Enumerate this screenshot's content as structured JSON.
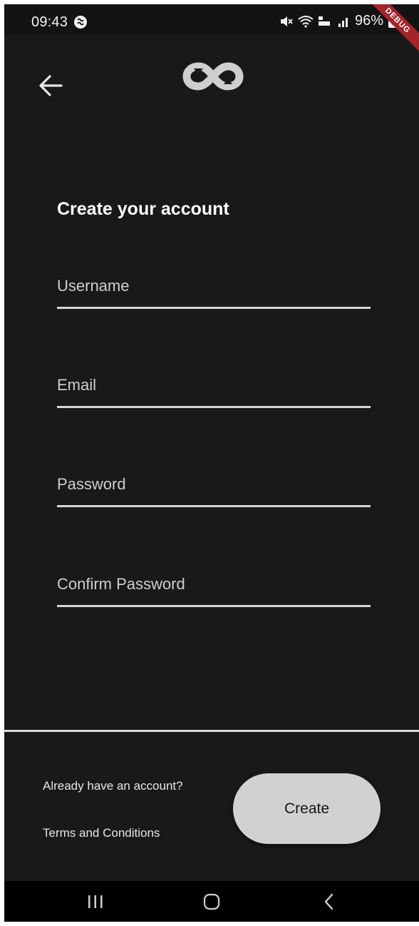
{
  "status_bar": {
    "time": "09:43",
    "battery": "96%",
    "icons": [
      "app-notification-icon",
      "mute-icon",
      "wifi-icon",
      "volte-icon",
      "signal-icon",
      "battery-charging-icon"
    ]
  },
  "debug_banner": "DEBUG",
  "header": {
    "back_icon": "arrow-left-icon",
    "logo": "infinity-logo"
  },
  "form": {
    "title": "Create your account",
    "fields": [
      {
        "placeholder": "Username",
        "value": ""
      },
      {
        "placeholder": "Email",
        "value": ""
      },
      {
        "placeholder": "Password",
        "value": ""
      },
      {
        "placeholder": "Confirm Password",
        "value": ""
      }
    ]
  },
  "footer": {
    "login_link": "Already have an account?",
    "terms_link": "Terms and Conditions",
    "create_button": "Create"
  },
  "nav_bar": {
    "icons": [
      "recent-apps-icon",
      "home-icon",
      "back-icon"
    ]
  },
  "colors": {
    "background": "#191919",
    "status_bar": "#131313",
    "text": "#ffffff",
    "button": "#d1d1d1",
    "underline": "#d6d6d6",
    "debug_banner": "#a3242a"
  }
}
